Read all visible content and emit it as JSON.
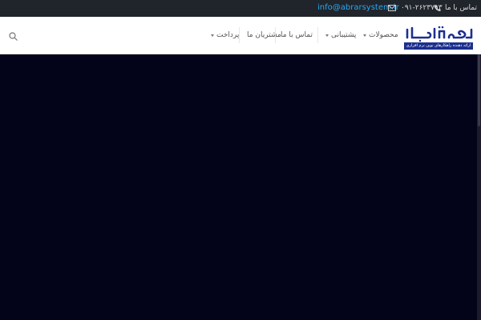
{
  "topbar": {
    "email": "info@abrarsystem.ir",
    "phone": "۰۹۱-۲۶۲۳۷۹۳",
    "contact_label": "تماس با ما",
    "mail_icon": "envelope-icon",
    "phone_icon": "phone-icon"
  },
  "header": {
    "search_icon": "search-icon",
    "logo": {
      "name": "ابرارسیستم",
      "tagline": "ارائه دهنده راهکارهای نوین نرم افزاری"
    },
    "menu": [
      {
        "label": "محصولات",
        "has_dropdown": true
      },
      {
        "label": "پشتیبانی",
        "has_dropdown": true
      },
      {
        "label": "تماس با ما",
        "has_dropdown": false
      },
      {
        "label": "مشتریان ما",
        "has_dropdown": false
      },
      {
        "label": "پرداخت",
        "has_dropdown": true
      }
    ]
  },
  "colors": {
    "topbar_bg": "#20242b",
    "email_link": "#29a7ef",
    "hero_bg": "#03031a",
    "brand_blue": "#1c2f8f"
  }
}
